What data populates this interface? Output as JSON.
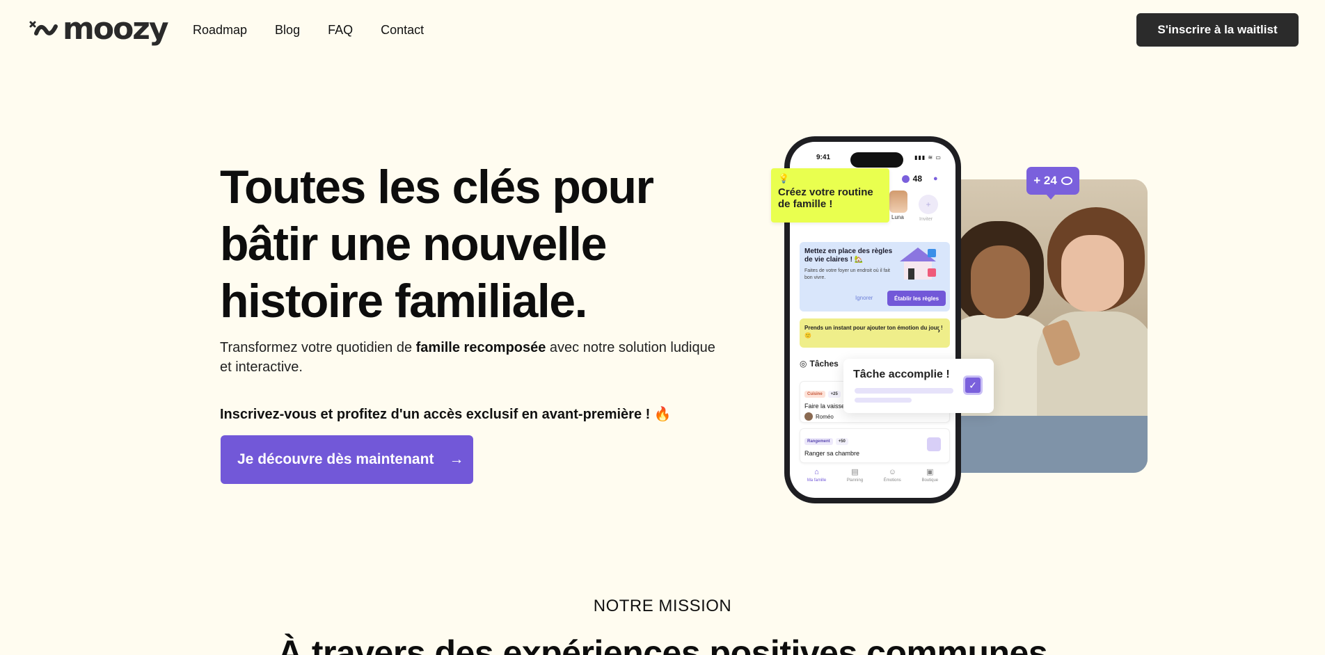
{
  "header": {
    "logo_text": "moozy",
    "nav": [
      "Roadmap",
      "Blog",
      "FAQ",
      "Contact"
    ],
    "waitlist_label": "S'inscrire à la waitlist"
  },
  "hero": {
    "title": "Toutes les clés pour bâtir une nouvelle histoire familiale.",
    "subtitle_before": "Transformez votre quotidien de ",
    "subtitle_bold": "famille recomposée",
    "subtitle_after": " avec notre solution ludique et interactive.",
    "cta_text": "Inscrivez-vous et profitez d'un accès exclusif en avant-première ! 🔥",
    "cta_button": "Je découvre dès maintenant",
    "cta_arrow": "→"
  },
  "phone": {
    "time": "9:41",
    "status_icons": "▮▮▮ ≋ ▭",
    "coins": "48",
    "avatar_luna": "Luna",
    "avatar_invite": "Inviter",
    "rules_card": {
      "title": "Mettez en place des règles de vie claires ! 🏡",
      "text": "Faites de votre foyer un endroit où il fait bon vivre.",
      "ignore": "Ignorer",
      "button": "Établir les règles"
    },
    "emotion_card": "Prends un instant pour ajouter ton émotion du jour ! 🙂",
    "tasks_title": "Tâches",
    "tasks": [
      {
        "tag": "Cuisine",
        "points": "+25",
        "name": "Faire la vaisselle",
        "user": "Roméo"
      },
      {
        "tag": "Rangement",
        "points": "+50",
        "name": "Ranger sa chambre"
      }
    ],
    "bottom_nav": [
      "Ma famille",
      "Planning",
      "Émotions",
      "Boutique"
    ]
  },
  "overlays": {
    "coin_badge": "+ 24",
    "routine_tip": "Créez votre routine de famille !",
    "done_toast": "Tâche accomplie !"
  },
  "mission": {
    "label": "NOTRE MISSION",
    "heading": "À travers des expériences positives communes"
  },
  "colors": {
    "background": "#fffcf0",
    "accent": "#7258d8",
    "dark_button": "#2b2b2b",
    "highlight": "#e9ff4f"
  }
}
